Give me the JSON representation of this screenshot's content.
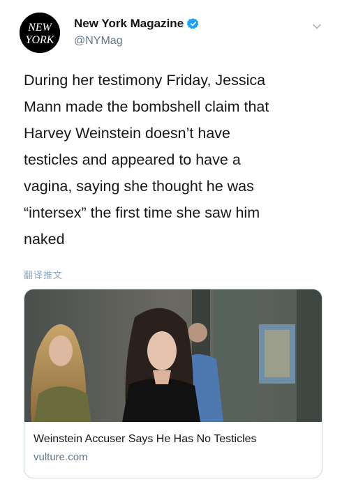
{
  "account": {
    "display_name": "New York Magazine",
    "handle": "@NYMag",
    "logo_text_top": "NEW",
    "logo_text_bottom": "YORK"
  },
  "tweet": {
    "text": "During her testimony Friday, Jessica\nMann made the bombshell claim that\nHarvey Weinstein doesn’t have\ntesticles and appeared to have a\nvagina, saying she thought he was\n“intersex” the first time she saw him\nnaked",
    "translate_label": "翻译推文"
  },
  "link_card": {
    "title": "Weinstein Accuser Says He Has No Testicles",
    "domain": "vulture.com"
  },
  "icons": {
    "verified": "verified-badge-icon",
    "menu": "chevron-down-icon"
  },
  "colors": {
    "verified_blue": "#1da1f2",
    "secondary_text": "#657786",
    "translate_link": "#8aa5bd",
    "border": "#ccd6dd"
  }
}
